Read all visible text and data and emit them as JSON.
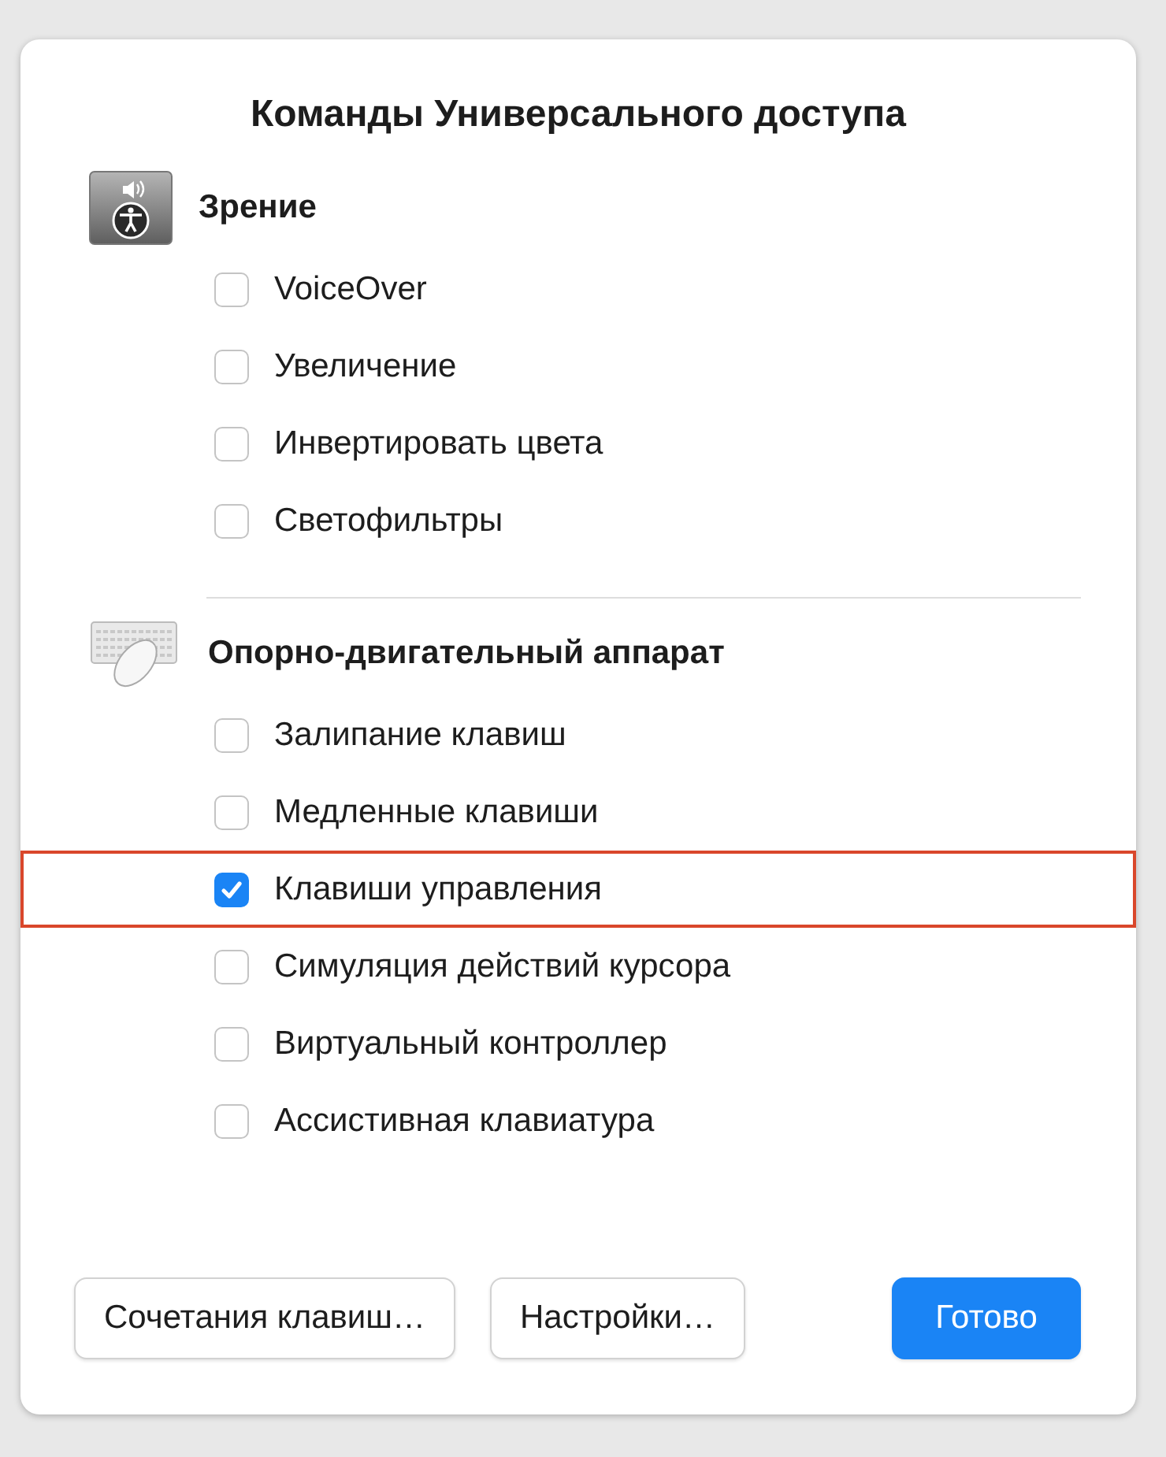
{
  "dialog": {
    "title": "Команды Универсального доступа"
  },
  "sections": [
    {
      "kind": "vision",
      "title": "Зрение",
      "items": [
        {
          "label": "VoiceOver",
          "checked": false,
          "highlighted": false
        },
        {
          "label": "Увеличение",
          "checked": false,
          "highlighted": false
        },
        {
          "label": "Инвертировать цвета",
          "checked": false,
          "highlighted": false
        },
        {
          "label": "Светофильтры",
          "checked": false,
          "highlighted": false
        }
      ]
    },
    {
      "kind": "motor",
      "title": "Опорно-двигательный аппарат",
      "items": [
        {
          "label": "Залипание клавиш",
          "checked": false,
          "highlighted": false
        },
        {
          "label": "Медленные клавиши",
          "checked": false,
          "highlighted": false
        },
        {
          "label": "Клавиши управления",
          "checked": true,
          "highlighted": true
        },
        {
          "label": "Симуляция действий курсора",
          "checked": false,
          "highlighted": false
        },
        {
          "label": "Виртуальный контроллер",
          "checked": false,
          "highlighted": false
        },
        {
          "label": "Ассистивная клавиатура",
          "checked": false,
          "highlighted": false
        }
      ]
    }
  ],
  "buttons": [
    {
      "label": "Сочетания клавиш…",
      "kind": "secondary"
    },
    {
      "label": "Настройки…",
      "kind": "secondary"
    },
    {
      "label": "Готово",
      "kind": "primary"
    }
  ]
}
